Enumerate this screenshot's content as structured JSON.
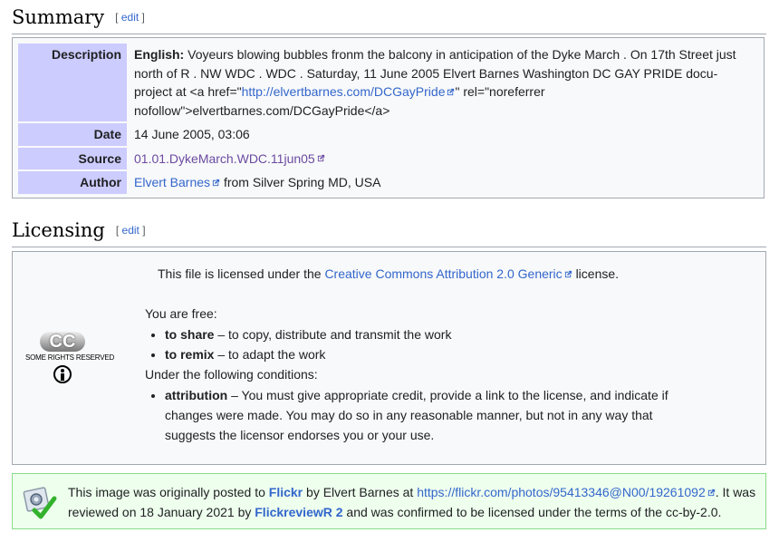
{
  "summary": {
    "heading": "Summary",
    "edit_label": "edit",
    "description_label": "Description",
    "description_lang": "English:",
    "description_text": "Voyeurs blowing bubbles fronm the balcony in anticipation of the Dyke March . On 17th Street just north of R . NW WDC . WDC . Saturday, 11 June 2005 Elvert Barnes Washington DC GAY PRIDE docu-project at <a href=\"",
    "description_link": "http://elvertbarnes.com/DCGayPride",
    "description_tail": "\" rel=\"noreferrer nofollow\">elvertbarnes.com/DCGayPride</a>",
    "date_label": "Date",
    "date_value": "14 June 2005, 03:06",
    "source_label": "Source",
    "source_value": "01.01.DykeMarch.WDC.11jun05",
    "author_label": "Author",
    "author_link": "Elvert Barnes",
    "author_tail": "from Silver Spring MD, USA"
  },
  "licensing": {
    "heading": "Licensing",
    "edit_label": "edit",
    "license_prefix": "This file is licensed under the",
    "license_link": "Creative Commons Attribution 2.0 Generic",
    "license_suffix": "license.",
    "free_label": "You are free:",
    "share_term": "to share",
    "share_desc": "– to copy, distribute and transmit the work",
    "remix_term": "to remix",
    "remix_desc": "– to adapt the work",
    "conditions_label": "Under the following conditions:",
    "attribution_term": "attribution",
    "attribution_desc": "– You must give appropriate credit, provide a link to the license, and indicate if changes were made. You may do so in any reasonable manner, but not in any way that suggests the licensor endorses you or your use.",
    "cc_badge": "CC",
    "cc_text": "SOME RIGHTS RESERVED"
  },
  "flickr": {
    "prefix": "This image was originally posted to",
    "flickr_link": "Flickr",
    "by_text": "by Elvert Barnes at",
    "url": "https://flickr.com/photos/95413346@N00/19261092",
    "mid_text": ". It was reviewed on 18 January 2021 by",
    "reviewer": "FlickreviewR 2",
    "suffix": "and was confirmed to be licensed under the terms of the cc-by-2.0."
  },
  "colors": {
    "link": "#3366cc",
    "visited_link": "#6b4ba1",
    "label_bg": "#ccccff",
    "flickr_bg": "#eeffee",
    "flickr_border": "#88dd88"
  }
}
